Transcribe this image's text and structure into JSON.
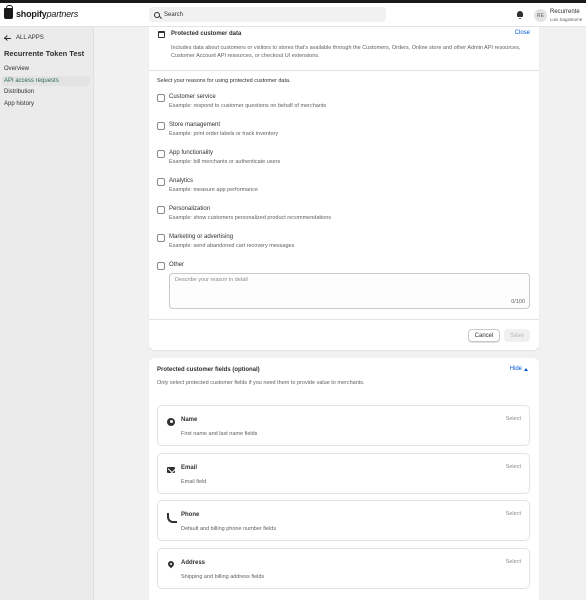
{
  "header": {
    "brand": "shopify",
    "brand_suffix": "partners",
    "search_placeholder": "Search",
    "avatar_initials": "RE",
    "user_name": "Recurrente",
    "user_sub": "Luis Sagastume"
  },
  "sidebar": {
    "back_label": "ALL APPS",
    "app_title": "Recurrente Token Test",
    "items": [
      {
        "label": "Overview",
        "active": false
      },
      {
        "label": "API access requests",
        "active": true
      },
      {
        "label": "Distribution",
        "active": false
      },
      {
        "label": "App history",
        "active": false
      }
    ]
  },
  "protected_data": {
    "title": "Protected customer data",
    "close_label": "Close",
    "description": "Includes data about customers or visitors to stores that's available through the Customers, Orders, Online store and other Admin API resources, Customer Account API resources, or checkout UI extensions.",
    "reasons_title": "Select your reasons for using protected customer data.",
    "reasons": [
      {
        "label": "Customer service",
        "example": "Example: respond to customer questions on behalf of merchants"
      },
      {
        "label": "Store management",
        "example": "Example: print order labels or track inventory"
      },
      {
        "label": "App functionality",
        "example": "Example: bill merchants or authenticate users"
      },
      {
        "label": "Analytics",
        "example": "Example: measure app performance"
      },
      {
        "label": "Personalization",
        "example": "Example: show customers personalized product recommendations"
      },
      {
        "label": "Marketing or advertising",
        "example": "Example: send abandoned cart recovery messages"
      },
      {
        "label": "Other",
        "example": ""
      }
    ],
    "other_placeholder": "Describe your reason in detail",
    "char_count": "0/100",
    "cancel_label": "Cancel",
    "save_label": "Save"
  },
  "fields": {
    "title": "Protected customer fields (optional)",
    "hide_label": "Hide",
    "description": "Only select protected customer fields if you need them to provide value to merchants.",
    "items": [
      {
        "name": "Name",
        "desc": "First name and last name fields",
        "action": "Select",
        "icon": "person-icon"
      },
      {
        "name": "Email",
        "desc": "Email field",
        "action": "Select",
        "icon": "mail-icon"
      },
      {
        "name": "Phone",
        "desc": "Default and billing phone number fields",
        "action": "Select",
        "icon": "phone-icon"
      },
      {
        "name": "Address",
        "desc": "Shipping and billing address fields",
        "action": "Select",
        "icon": "location-pin-icon"
      }
    ]
  },
  "colors": {
    "link": "#005bd3",
    "active_nav_text": "#2e6c4f",
    "page_bg": "#f1f1f1"
  }
}
